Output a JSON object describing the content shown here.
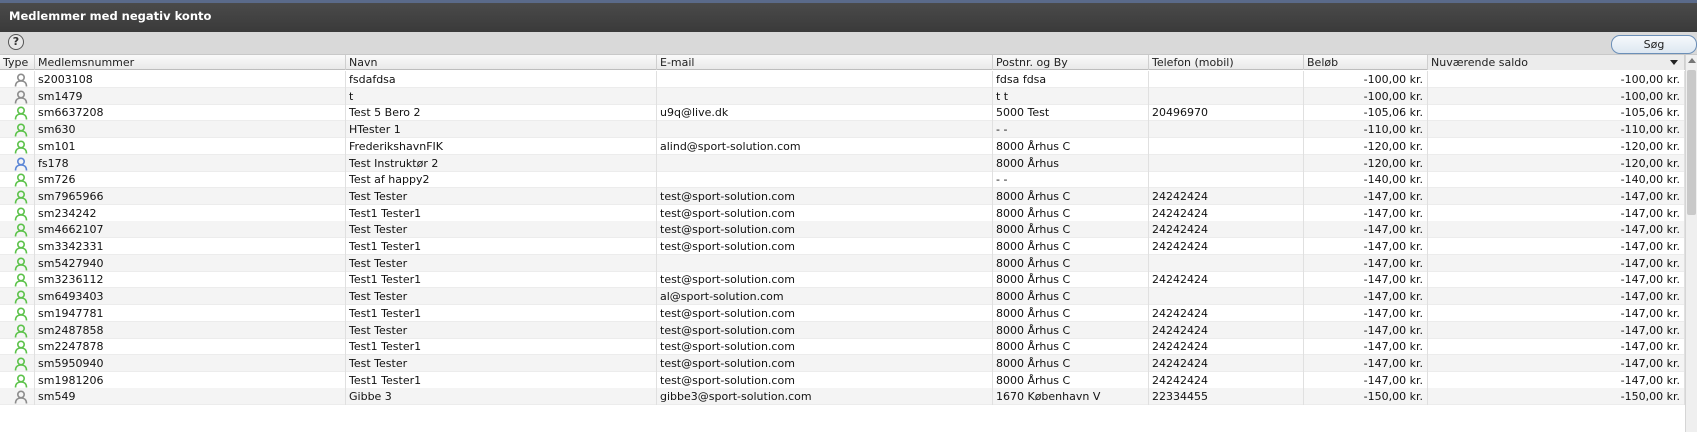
{
  "window": {
    "title": "Medlemmer med negativ konto"
  },
  "toolbar": {
    "help_label": "?",
    "search_label": "Søg"
  },
  "colors": {
    "green_user": "#5cc24a",
    "gray_user": "#8c8c8c",
    "blue_user": "#5b86d6"
  },
  "columns": [
    "Type",
    "Medlemsnummer",
    "Navn",
    "E-mail",
    "Postnr. og By",
    "Telefon (mobil)",
    "Beløb",
    "Nuværende saldo"
  ],
  "rows": [
    {
      "type": "gray-user-icon",
      "nr": "s2003108",
      "navn": "fsdafdsa",
      "email": "",
      "by": "fdsa fdsa",
      "tlf": "",
      "belob": "-100,00 kr.",
      "saldo": "-100,00 kr."
    },
    {
      "type": "gray-user-icon",
      "nr": "sm1479",
      "navn": "t",
      "email": "",
      "by": "t t",
      "tlf": "",
      "belob": "-100,00 kr.",
      "saldo": "-100,00 kr."
    },
    {
      "type": "green-user-icon",
      "nr": "sm6637208",
      "navn": "Test 5 Bero 2",
      "email": "u9q@live.dk",
      "by": "5000 Test",
      "tlf": "20496970",
      "belob": "-105,06 kr.",
      "saldo": "-105,06 kr."
    },
    {
      "type": "green-user-icon",
      "nr": "sm630",
      "navn": "HTester 1",
      "email": "",
      "by": "- -",
      "tlf": "",
      "belob": "-110,00 kr.",
      "saldo": "-110,00 kr."
    },
    {
      "type": "green-user-icon",
      "nr": "sm101",
      "navn": "FrederikshavnFIK",
      "email": "alind@sport-solution.com",
      "by": "8000 Århus C",
      "tlf": "",
      "belob": "-120,00 kr.",
      "saldo": "-120,00 kr."
    },
    {
      "type": "blue-user-icon",
      "nr": "fs178",
      "navn": "Test Instruktør 2",
      "email": "",
      "by": "8000 Århus",
      "tlf": "",
      "belob": "-120,00 kr.",
      "saldo": "-120,00 kr."
    },
    {
      "type": "green-user-icon",
      "nr": "sm726",
      "navn": "Test af happy2",
      "email": "",
      "by": "- -",
      "tlf": "",
      "belob": "-140,00 kr.",
      "saldo": "-140,00 kr."
    },
    {
      "type": "green-user-icon",
      "nr": "sm7965966",
      "navn": "Test Tester",
      "email": "test@sport-solution.com",
      "by": "8000 Århus C",
      "tlf": "24242424",
      "belob": "-147,00 kr.",
      "saldo": "-147,00 kr."
    },
    {
      "type": "green-user-icon",
      "nr": "sm234242",
      "navn": "Test1 Tester1",
      "email": "test@sport-solution.com",
      "by": "8000 Århus C",
      "tlf": "24242424",
      "belob": "-147,00 kr.",
      "saldo": "-147,00 kr."
    },
    {
      "type": "green-user-icon",
      "nr": "sm4662107",
      "navn": "Test Tester",
      "email": "test@sport-solution.com",
      "by": "8000 Århus C",
      "tlf": "24242424",
      "belob": "-147,00 kr.",
      "saldo": "-147,00 kr."
    },
    {
      "type": "green-user-icon",
      "nr": "sm3342331",
      "navn": "Test1 Tester1",
      "email": "test@sport-solution.com",
      "by": "8000 Århus C",
      "tlf": "24242424",
      "belob": "-147,00 kr.",
      "saldo": "-147,00 kr."
    },
    {
      "type": "green-user-icon",
      "nr": "sm5427940",
      "navn": "Test Tester",
      "email": "",
      "by": "8000 Århus C",
      "tlf": "",
      "belob": "-147,00 kr.",
      "saldo": "-147,00 kr."
    },
    {
      "type": "green-user-icon",
      "nr": "sm3236112",
      "navn": "Test1 Tester1",
      "email": "test@sport-solution.com",
      "by": "8000 Århus C",
      "tlf": "24242424",
      "belob": "-147,00 kr.",
      "saldo": "-147,00 kr."
    },
    {
      "type": "green-user-icon",
      "nr": "sm6493403",
      "navn": "Test Tester",
      "email": "al@sport-solution.com",
      "by": "8000 Århus C",
      "tlf": "",
      "belob": "-147,00 kr.",
      "saldo": "-147,00 kr."
    },
    {
      "type": "green-user-icon",
      "nr": "sm1947781",
      "navn": "Test1 Tester1",
      "email": "test@sport-solution.com",
      "by": "8000 Århus C",
      "tlf": "24242424",
      "belob": "-147,00 kr.",
      "saldo": "-147,00 kr."
    },
    {
      "type": "green-user-icon",
      "nr": "sm2487858",
      "navn": "Test Tester",
      "email": "test@sport-solution.com",
      "by": "8000 Århus C",
      "tlf": "24242424",
      "belob": "-147,00 kr.",
      "saldo": "-147,00 kr."
    },
    {
      "type": "green-user-icon",
      "nr": "sm2247878",
      "navn": "Test1 Tester1",
      "email": "test@sport-solution.com",
      "by": "8000 Århus C",
      "tlf": "24242424",
      "belob": "-147,00 kr.",
      "saldo": "-147,00 kr."
    },
    {
      "type": "green-user-icon",
      "nr": "sm5950940",
      "navn": "Test Tester",
      "email": "test@sport-solution.com",
      "by": "8000 Århus C",
      "tlf": "24242424",
      "belob": "-147,00 kr.",
      "saldo": "-147,00 kr."
    },
    {
      "type": "green-user-icon",
      "nr": "sm1981206",
      "navn": "Test1 Tester1",
      "email": "test@sport-solution.com",
      "by": "8000 Århus C",
      "tlf": "24242424",
      "belob": "-147,00 kr.",
      "saldo": "-147,00 kr."
    },
    {
      "type": "gray-user-icon",
      "nr": "sm549",
      "navn": "Gibbe 3",
      "email": "gibbe3@sport-solution.com",
      "by": "1670 København V",
      "tlf": "22334455",
      "belob": "-150,00 kr.",
      "saldo": "-150,00 kr."
    }
  ]
}
